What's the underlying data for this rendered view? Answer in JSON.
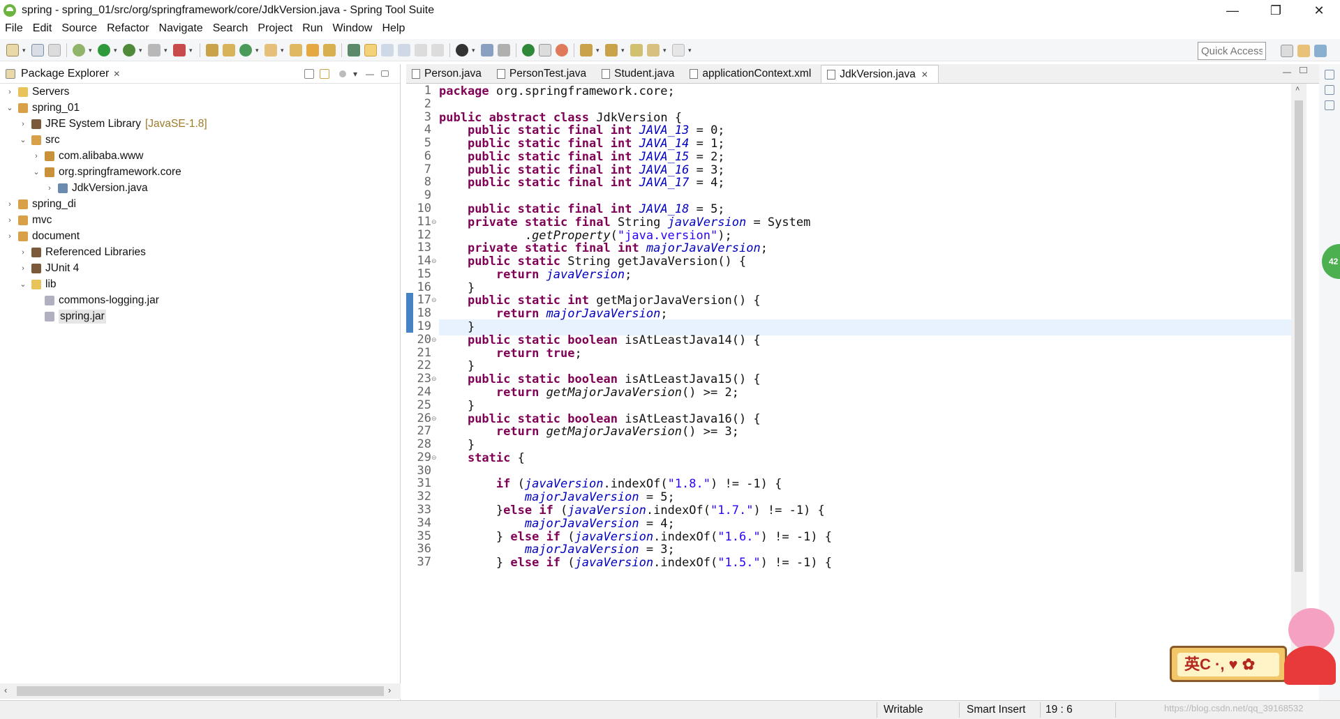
{
  "window": {
    "title": "spring - spring_01/src/org/springframework/core/JdkVersion.java - Spring Tool Suite",
    "min_glyph": "—",
    "max_glyph": "❐",
    "close_glyph": "✕"
  },
  "menu": [
    "File",
    "Edit",
    "Source",
    "Refactor",
    "Navigate",
    "Search",
    "Project",
    "Run",
    "Window",
    "Help"
  ],
  "toolbar": {
    "quick_access_placeholder": "Quick Access"
  },
  "package_explorer": {
    "title": "Package Explorer",
    "close": "✕",
    "tree": [
      {
        "label": "Servers",
        "twisty": "›",
        "depth": 0,
        "icon": "folder-icon"
      },
      {
        "label": "spring_01",
        "twisty": "⌄",
        "depth": 0,
        "icon": "project-icon"
      },
      {
        "label": "JRE System Library",
        "decor": "[JavaSE-1.8]",
        "twisty": "›",
        "depth": 1,
        "icon": "library-icon"
      },
      {
        "label": "src",
        "twisty": "⌄",
        "depth": 1,
        "icon": "source-folder-icon"
      },
      {
        "label": "com.alibaba.www",
        "twisty": "›",
        "depth": 2,
        "icon": "package-icon"
      },
      {
        "label": "org.springframework.core",
        "twisty": "⌄",
        "depth": 2,
        "icon": "package-icon"
      },
      {
        "label": "JdkVersion.java",
        "twisty": "›",
        "depth": 3,
        "icon": "java-file-icon"
      },
      {
        "label": "spring_di",
        "twisty": "›",
        "depth": 0,
        "icon": "project-icon"
      },
      {
        "label": "mvc",
        "twisty": "›",
        "depth": 0,
        "icon": "project-icon"
      },
      {
        "label": "document",
        "twisty": "›",
        "depth": 0,
        "icon": "project-icon"
      },
      {
        "label": "Referenced Libraries",
        "twisty": "›",
        "depth": 1,
        "icon": "library-icon"
      },
      {
        "label": "JUnit 4",
        "twisty": "›",
        "depth": 1,
        "icon": "library-icon"
      },
      {
        "label": "lib",
        "twisty": "⌄",
        "depth": 1,
        "icon": "folder-icon"
      },
      {
        "label": "commons-logging.jar",
        "twisty": "",
        "depth": 2,
        "icon": "jar-icon"
      },
      {
        "label": "spring.jar",
        "twisty": "",
        "depth": 2,
        "icon": "jar-icon",
        "selected": true
      }
    ]
  },
  "editor_tabs": [
    {
      "label": "Person.java",
      "active": false
    },
    {
      "label": "PersonTest.java",
      "active": false
    },
    {
      "label": "Student.java",
      "active": false
    },
    {
      "label": "applicationContext.xml",
      "active": false
    },
    {
      "label": "JdkVersion.java",
      "active": true
    }
  ],
  "code_lines": [
    "package org.springframework.core;",
    "",
    "public abstract class JdkVersion {",
    "    public static final int JAVA_13 = 0;",
    "    public static final int JAVA_14 = 1;",
    "    public static final int JAVA_15 = 2;",
    "    public static final int JAVA_16 = 3;",
    "    public static final int JAVA_17 = 4;",
    "",
    "    public static final int JAVA_18 = 5;",
    "    private static final String javaVersion = System",
    "            .getProperty(\"java.version\");",
    "    private static final int majorJavaVersion;",
    "    public static String getJavaVersion() {",
    "        return javaVersion;",
    "    }",
    "    public static int getMajorJavaVersion() {",
    "        return majorJavaVersion;",
    "    }",
    "    public static boolean isAtLeastJava14() {",
    "        return true;",
    "    }",
    "    public static boolean isAtLeastJava15() {",
    "        return getMajorJavaVersion() >= 2;",
    "    }",
    "    public static boolean isAtLeastJava16() {",
    "        return getMajorJavaVersion() >= 3;",
    "    }",
    "    static {",
    "",
    "        if (javaVersion.indexOf(\"1.8.\") != -1) {",
    "            majorJavaVersion = 5;",
    "        }else if (javaVersion.indexOf(\"1.7.\") != -1) {",
    "            majorJavaVersion = 4;",
    "        } else if (javaVersion.indexOf(\"1.6.\") != -1) {",
    "            majorJavaVersion = 3;",
    "        } else if (javaVersion.indexOf(\"1.5.\") != -1) {"
  ],
  "fold_lines": [
    11,
    14,
    17,
    20,
    23,
    26,
    29
  ],
  "status": {
    "writable": "Writable",
    "insert_mode": "Smart Insert",
    "position": "19 : 6"
  },
  "overlays": {
    "badge": "42",
    "ime_text": "英C ·, ♥ ✿",
    "watermark": "https://blog.csdn.net/qq_39168532"
  },
  "colors": {
    "keyword": "#7f0055",
    "field": "#0000c0",
    "string": "#2a00ff",
    "current_line": "#e8f2fe"
  }
}
